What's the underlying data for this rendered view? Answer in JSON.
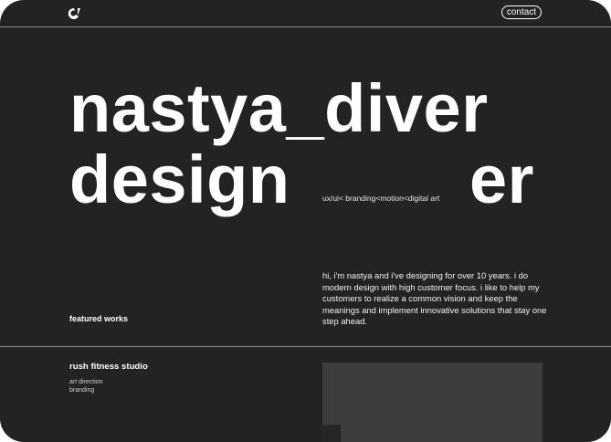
{
  "header": {
    "logo_icon": "logo-mark-icon",
    "contact_label": "contact"
  },
  "hero": {
    "line1": "nastya_diver",
    "line2_left": "design",
    "line2_right": "er",
    "skills": "ux/ui< branding<motion<digital art"
  },
  "intro": {
    "text": "hi, i'm nastya and i've designing for over 10 years. i do modern design with high customer focus. i like to help my customers to realize a common vision and keep the meanings and implement innovative solutions that stay one step ahead."
  },
  "featured": {
    "label": "featured works"
  },
  "works": [
    {
      "title": "rush fitness studio",
      "tags": [
        "art direction",
        "branding"
      ]
    }
  ],
  "colors": {
    "background": "#232323",
    "text": "#ffffff",
    "rule": "#8a8a8a",
    "preview": "#3d3d3d"
  }
}
